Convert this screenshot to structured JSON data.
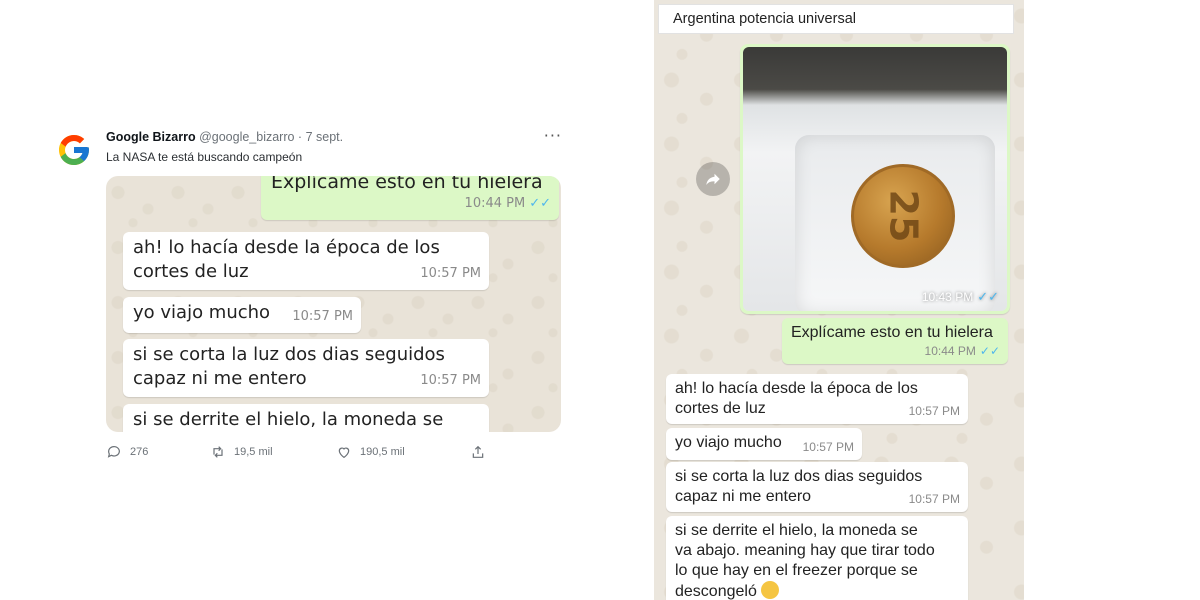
{
  "tweet": {
    "author_name": "Google Bizarro",
    "author_meta": "@google_bizarro · 7 sept.",
    "more_label": "···",
    "text": "La NASA te está buscando campeón",
    "chat": {
      "out_message": "Explícame esto en tu hielera",
      "out_time": "10:44 PM",
      "messages": [
        {
          "text_line1": "ah! lo hacía desde la época de los",
          "text_line2": "cortes de luz",
          "time": "10:57 PM"
        },
        {
          "text_line1": "yo viajo mucho",
          "time": "10:57 PM"
        },
        {
          "text_line1": "si se corta la luz dos dias seguidos",
          "text_line2": "capaz ni me entero",
          "time": "10:57 PM"
        },
        {
          "text_line1": "si se derrite el hielo, la moneda se"
        }
      ]
    },
    "actions": {
      "replies": "276",
      "retweets": "19,5 mil",
      "likes": "190,5 mil"
    }
  },
  "whatsapp": {
    "title": "Argentina potencia universal",
    "image_time": "10:43 PM",
    "coin_value": "25",
    "out_message": "Explícame esto en tu hielera",
    "out_time": "10:44 PM",
    "messages": [
      {
        "line1": "ah! lo hacía desde la época de los",
        "line2": "cortes de luz",
        "time": "10:57 PM"
      },
      {
        "line1": "yo viajo mucho",
        "time": "10:57 PM"
      },
      {
        "line1": "si se corta la luz dos dias seguidos",
        "line2": "capaz ni me entero",
        "time": "10:57 PM"
      },
      {
        "line1": "si se derrite el hielo, la moneda se",
        "line2": "va abajo. meaning hay que tirar todo",
        "line3": "lo que hay en el freezer porque se",
        "line4": "descongeló"
      }
    ]
  },
  "colors": {
    "incoming_bubble": "#ffffff",
    "outgoing_bubble": "#dcf8c6",
    "chat_background": "#ebe6dd",
    "read_ticks": "#4fb6ec"
  }
}
